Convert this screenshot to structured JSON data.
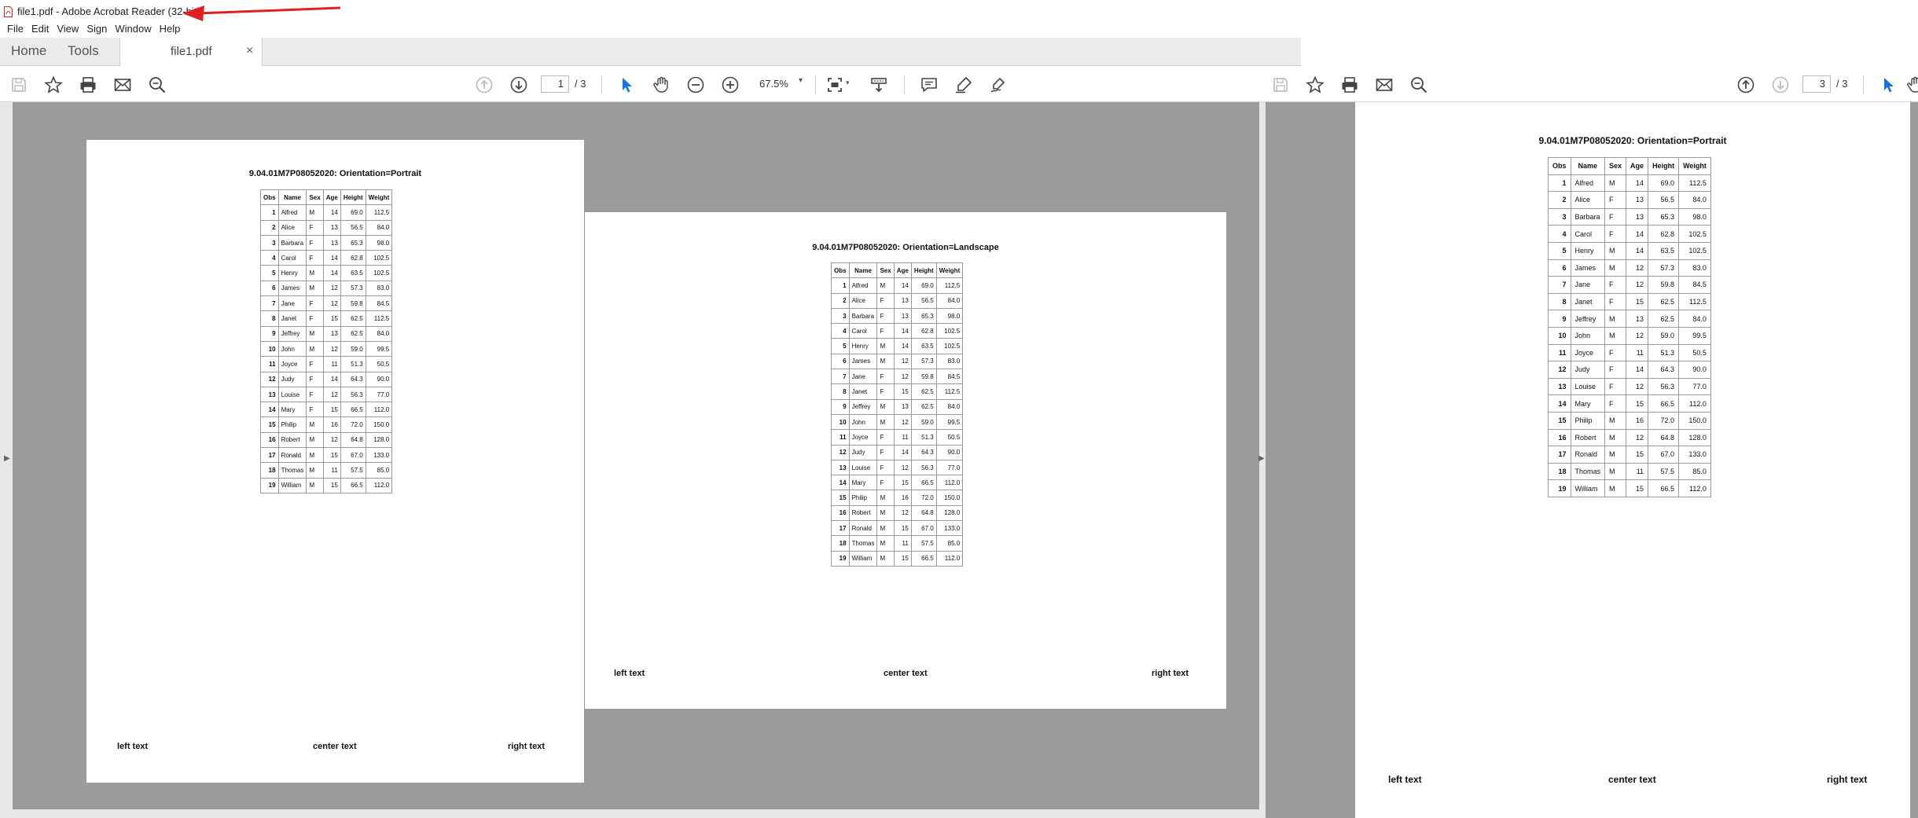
{
  "window": {
    "title": "file1.pdf - Adobe Acrobat Reader (32-bit)"
  },
  "menu": [
    "File",
    "Edit",
    "View",
    "Sign",
    "Window",
    "Help"
  ],
  "tabs": {
    "home": "Home",
    "tools": "Tools",
    "document": "file1.pdf",
    "close": "×"
  },
  "toolbar_left": {
    "current_page": "1",
    "total_pages": "/ 3",
    "zoom": "67.5%"
  },
  "toolbar_right": {
    "current_page": "3",
    "total_pages": "/ 3"
  },
  "icons": [
    "pdf-icon",
    "save-icon",
    "star-icon",
    "print-icon",
    "mail-icon",
    "search-icon",
    "page-up-icon",
    "page-down-icon",
    "cursor-icon",
    "hand-icon",
    "zoom-out-icon",
    "zoom-in-icon",
    "fit-page-icon",
    "scroll-mode-icon",
    "comment-icon",
    "highlight-icon",
    "sign-icon",
    "annotation-arrow"
  ],
  "colors": {
    "accent": "#1473e6",
    "arrow": "#e02020",
    "doc_background": "#9b9b9b"
  },
  "pages": {
    "portrait_title": "9.04.01M7P08052020: Orientation=Portrait",
    "landscape_title": "9.04.01M7P08052020: Orientation=Landscape",
    "footer_left": "left text",
    "footer_center": "center text",
    "footer_right": "right text"
  },
  "table": {
    "headers": [
      "Obs",
      "Name",
      "Sex",
      "Age",
      "Height",
      "Weight"
    ],
    "rows": [
      [
        "1",
        "Alfred",
        "M",
        "14",
        "69.0",
        "112.5"
      ],
      [
        "2",
        "Alice",
        "F",
        "13",
        "56.5",
        "84.0"
      ],
      [
        "3",
        "Barbara",
        "F",
        "13",
        "65.3",
        "98.0"
      ],
      [
        "4",
        "Carol",
        "F",
        "14",
        "62.8",
        "102.5"
      ],
      [
        "5",
        "Henry",
        "M",
        "14",
        "63.5",
        "102.5"
      ],
      [
        "6",
        "James",
        "M",
        "12",
        "57.3",
        "83.0"
      ],
      [
        "7",
        "Jane",
        "F",
        "12",
        "59.8",
        "84.5"
      ],
      [
        "8",
        "Janet",
        "F",
        "15",
        "62.5",
        "112.5"
      ],
      [
        "9",
        "Jeffrey",
        "M",
        "13",
        "62.5",
        "84.0"
      ],
      [
        "10",
        "John",
        "M",
        "12",
        "59.0",
        "99.5"
      ],
      [
        "11",
        "Joyce",
        "F",
        "11",
        "51.3",
        "50.5"
      ],
      [
        "12",
        "Judy",
        "F",
        "14",
        "64.3",
        "90.0"
      ],
      [
        "13",
        "Louise",
        "F",
        "12",
        "56.3",
        "77.0"
      ],
      [
        "14",
        "Mary",
        "F",
        "15",
        "66.5",
        "112.0"
      ],
      [
        "15",
        "Philip",
        "M",
        "16",
        "72.0",
        "150.0"
      ],
      [
        "16",
        "Robert",
        "M",
        "12",
        "64.8",
        "128.0"
      ],
      [
        "17",
        "Ronald",
        "M",
        "15",
        "67.0",
        "133.0"
      ],
      [
        "18",
        "Thomas",
        "M",
        "11",
        "57.5",
        "85.0"
      ],
      [
        "19",
        "William",
        "M",
        "15",
        "66.5",
        "112.0"
      ]
    ]
  }
}
